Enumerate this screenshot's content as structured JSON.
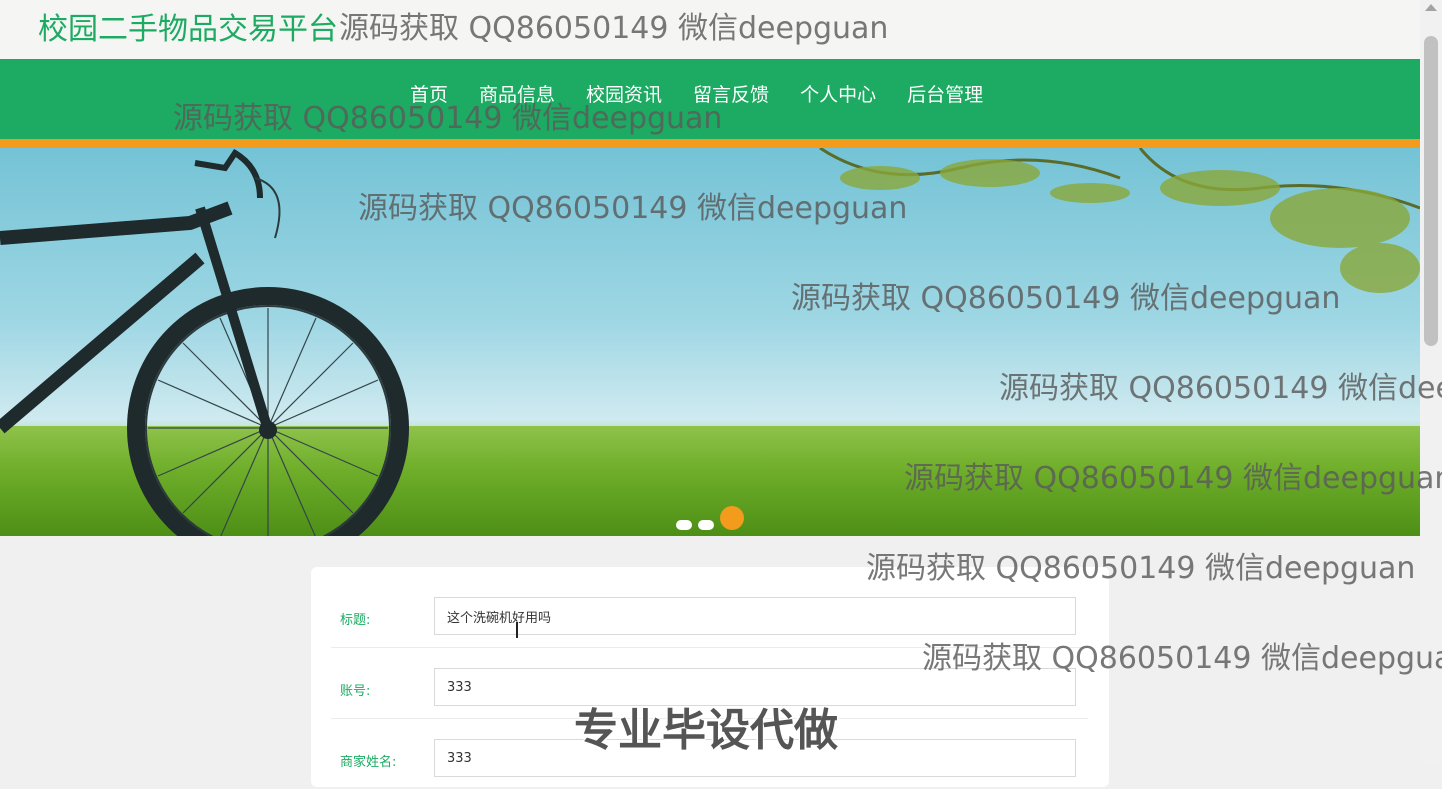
{
  "site": {
    "title": "校园二手物品交易平台"
  },
  "nav": {
    "items": [
      "首页",
      "商品信息",
      "校园资讯",
      "留言反馈",
      "个人中心",
      "后台管理"
    ]
  },
  "carousel": {
    "slide_count": 3,
    "active_index": 2
  },
  "form": {
    "title_label": "标题:",
    "title_value": "这个洗碗机好用吗",
    "account_label": "账号:",
    "account_value": "333",
    "merchant_label": "商家姓名:",
    "merchant_value": "333"
  },
  "watermarks": {
    "contact": "源码获取 QQ86050149 微信deepguan",
    "contact_cut1": "源码获取 QQ86050149 微信dee",
    "contact_cut2": "源码获取 QQ86050149 微信deepgua",
    "service": "专业毕设代做"
  },
  "colors": {
    "brand_green": "#1daa62",
    "accent_orange": "#f29b1d"
  }
}
